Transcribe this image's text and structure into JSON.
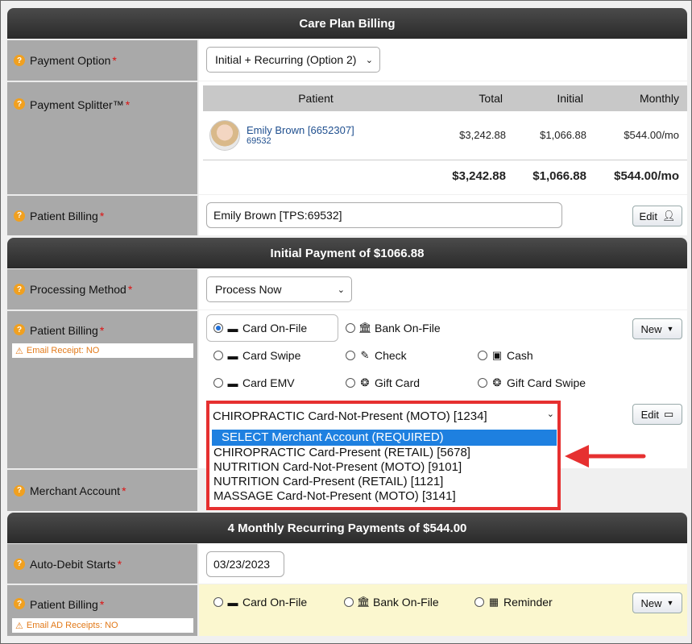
{
  "care_plan": {
    "title": "Care Plan Billing",
    "payment_option_label": "Payment Option",
    "payment_option_value": "Initial + Recurring (Option 2)",
    "payment_splitter_label": "Payment Splitter™",
    "splitter": {
      "headers": [
        "Patient",
        "Total",
        "Initial",
        "Monthly"
      ],
      "patient_name": "Emily Brown [6652307]",
      "patient_sub": "69532",
      "row_total": "$3,242.88",
      "row_initial": "$1,066.88",
      "row_monthly": "$544.00/mo",
      "sum_total": "$3,242.88",
      "sum_initial": "$1,066.88",
      "sum_monthly": "$544.00/mo"
    },
    "patient_billing_label": "Patient Billing",
    "patient_billing_value": "Emily Brown [TPS:69532]",
    "edit_label": "Edit"
  },
  "initial": {
    "title": "Initial Payment of $1066.88",
    "processing_label": "Processing Method",
    "processing_value": "Process Now",
    "patient_billing_label": "Patient Billing",
    "email_receipt": "Email Receipt: NO",
    "new_label": "New",
    "edit_label": "Edit",
    "methods": {
      "card_on_file": "Card On-File",
      "bank_on_file": "Bank On-File",
      "card_swipe": "Card Swipe",
      "check": "Check",
      "cash": "Cash",
      "card_emv": "Card EMV",
      "gift_card": "Gift Card",
      "gift_card_swipe": "Gift Card Swipe"
    },
    "merchant_label": "Merchant Account",
    "merchant_selected": "CHIROPRACTIC Card-Not-Present (MOTO) [1234]",
    "merchant_options": [
      "SELECT Merchant Account (REQUIRED)",
      "CHIROPRACTIC Card-Present (RETAIL) [5678]",
      "NUTRITION Card-Not-Present (MOTO) [9101]",
      "NUTRITION Card-Present (RETAIL) [1121]",
      "MASSAGE Card-Not-Present (MOTO) [3141]"
    ]
  },
  "monthly": {
    "title": "4 Monthly Recurring Payments of $544.00",
    "auto_debit_label": "Auto-Debit Starts",
    "auto_debit_value": "03/23/2023",
    "patient_billing_label": "Patient Billing",
    "email_ad": "Email AD Receipts: NO",
    "card_on_file": "Card On-File",
    "bank_on_file": "Bank On-File",
    "reminder": "Reminder",
    "new_label": "New"
  },
  "colors": {
    "header": "#333333",
    "label_bg": "#a9a9a9",
    "highlight": "#e63030",
    "selected": "#1e80e0",
    "warning": "#e27a1a",
    "yellow_bg": "#fbf7cf"
  }
}
